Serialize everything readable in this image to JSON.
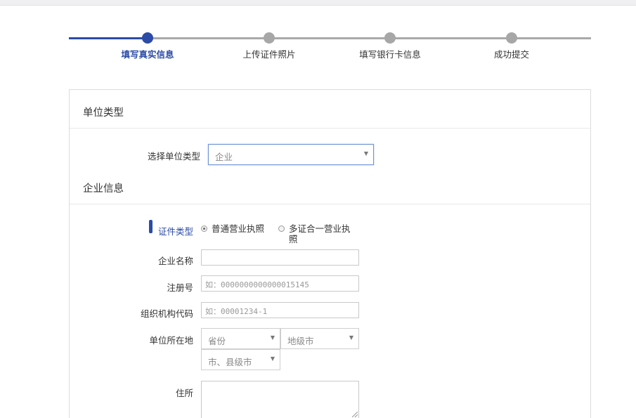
{
  "steps": [
    {
      "label": "填写真实信息",
      "active": true
    },
    {
      "label": "上传证件照片",
      "active": false
    },
    {
      "label": "填写银行卡信息",
      "active": false
    },
    {
      "label": "成功提交",
      "active": false
    }
  ],
  "unit_type_section": {
    "title": "单位类型",
    "select_label": "选择单位类型",
    "select_value": "企业"
  },
  "company_section": {
    "title": "企业信息",
    "cert_type_label": "证件类型",
    "cert_options": [
      {
        "label": "普通营业执照",
        "checked": true
      },
      {
        "label": "多证合一营业执照",
        "checked": false
      }
    ],
    "company_name_label": "企业名称",
    "company_name_value": "",
    "reg_no_label": "注册号",
    "reg_no_placeholder": "如：0000000000000015145",
    "org_code_label": "组织机构代码",
    "org_code_placeholder": "如：00001234-1",
    "location_label": "单位所在地",
    "province_value": "省份",
    "city_value": "地级市",
    "county_value": "市、县级市",
    "address_label": "住所"
  },
  "colors": {
    "accent": "#2b4ba7",
    "inactive": "#a7a7a7"
  },
  "icons": {
    "dropdown": "caret-down-icon",
    "textarea_grip": "resize-grip-icon"
  }
}
